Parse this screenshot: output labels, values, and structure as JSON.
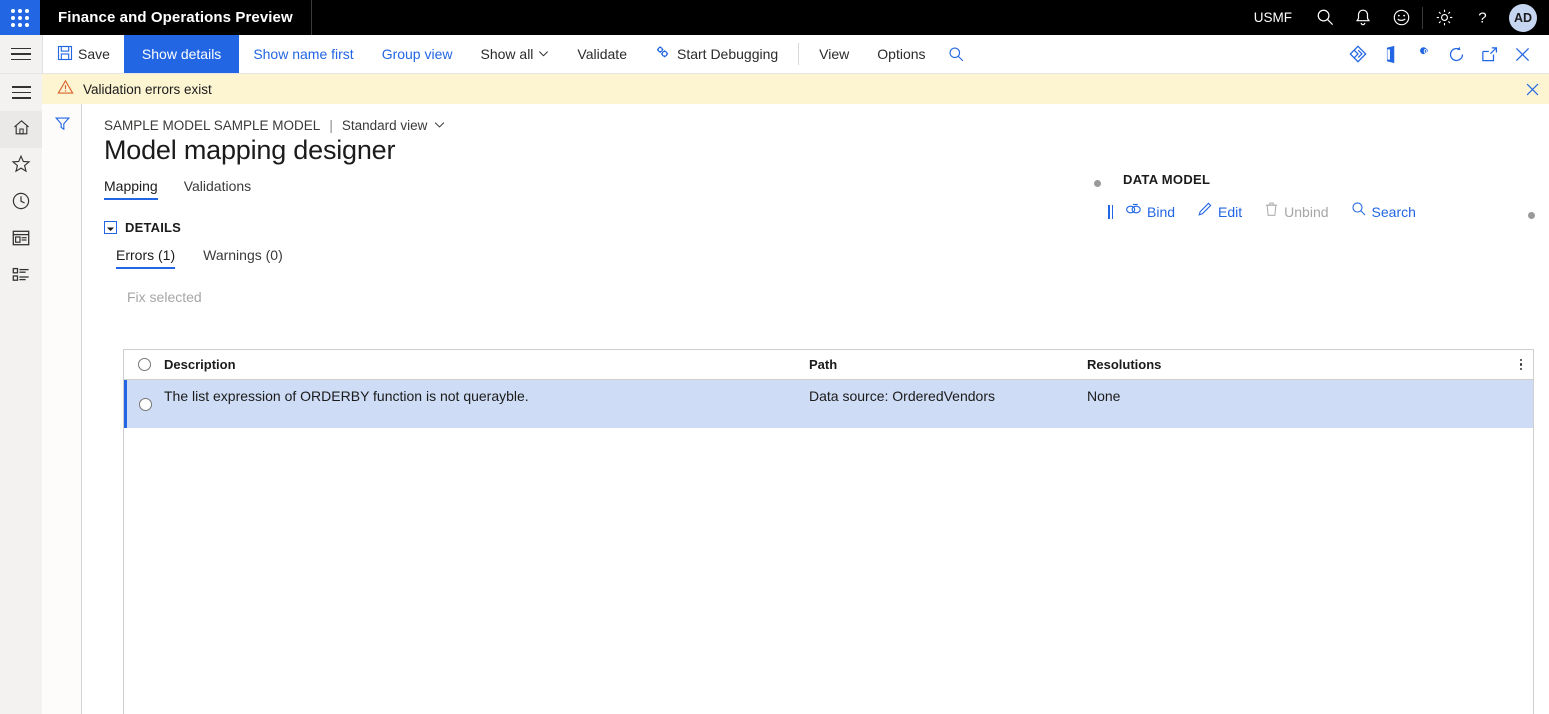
{
  "header": {
    "waffle_icon": "app-launcher-icon",
    "title": "Finance and Operations Preview",
    "company": "USMF",
    "icons": [
      {
        "name": "search-icon"
      },
      {
        "name": "notifications-bell-icon"
      },
      {
        "name": "feedback-smiley-icon"
      },
      {
        "name": "settings-gear-icon"
      },
      {
        "name": "help-question-icon"
      }
    ],
    "avatar_initials": "AD"
  },
  "action_bar": {
    "hamburger_icon": "hamburger-menu-icon",
    "save": "Save",
    "save_icon": "save-floppy-icon",
    "show_details": "Show details",
    "show_name_first": "Show name first",
    "group_view": "Group view",
    "show_all": "Show all",
    "validate": "Validate",
    "start_debugging": "Start Debugging",
    "start_debugging_icon": "gears-debug-icon",
    "view": "View",
    "options": "Options",
    "search_icon": "search-icon",
    "right_icons": [
      {
        "name": "diamond-personalize-icon"
      },
      {
        "name": "office-app-icon"
      },
      {
        "name": "attachments-icon",
        "badge": "0"
      },
      {
        "name": "refresh-icon"
      },
      {
        "name": "open-in-new-window-icon"
      },
      {
        "name": "close-icon"
      }
    ]
  },
  "message_bar": {
    "icon": "warning-triangle-icon",
    "text": "Validation errors exist",
    "close_icon": "close-icon",
    "background": "#FDF4D2"
  },
  "nav_rail": {
    "items": [
      {
        "name": "hamburger-menu-icon"
      },
      {
        "name": "home-icon"
      },
      {
        "name": "favorites-star-icon"
      },
      {
        "name": "recent-clock-icon"
      },
      {
        "name": "workspaces-icon"
      },
      {
        "name": "modules-list-icon"
      }
    ]
  },
  "filter_strip": {
    "icon": "filter-funnel-icon"
  },
  "content": {
    "breadcrumb_main": "SAMPLE MODEL SAMPLE MODEL",
    "breadcrumb_separator": "|",
    "breadcrumb_view": "Standard view",
    "page_title": "Model mapping designer",
    "tabs": [
      {
        "label": "Mapping",
        "selected": true
      },
      {
        "label": "Validations",
        "selected": false
      }
    ]
  },
  "data_model": {
    "title": "DATA MODEL",
    "actions": [
      {
        "label": "Bind",
        "icon": "link-bind-icon",
        "disabled": false
      },
      {
        "label": "Edit",
        "icon": "pencil-edit-icon",
        "disabled": false
      },
      {
        "label": "Unbind",
        "icon": "trash-unbind-icon",
        "disabled": true
      },
      {
        "label": "Search",
        "icon": "search-icon",
        "disabled": false
      }
    ]
  },
  "details": {
    "label": "DETAILS",
    "expanded": true,
    "sub_tabs": [
      {
        "label": "Errors (1)",
        "selected": true
      },
      {
        "label": "Warnings (0)",
        "selected": false
      }
    ],
    "fix_selected": "Fix selected"
  },
  "grid": {
    "columns": [
      "Description",
      "Path",
      "Resolutions"
    ],
    "rows": [
      {
        "description": "The list expression of ORDERBY function is not querayble.",
        "path": "Data source: OrderedVendors",
        "resolutions": "None",
        "selected": true
      }
    ]
  },
  "colors": {
    "accent": "#2266E3",
    "header_bg": "#000000",
    "warning_bg": "#FDF4D2",
    "row_selected": "#CEDCF5",
    "rail_bg": "#f3f2f1"
  }
}
